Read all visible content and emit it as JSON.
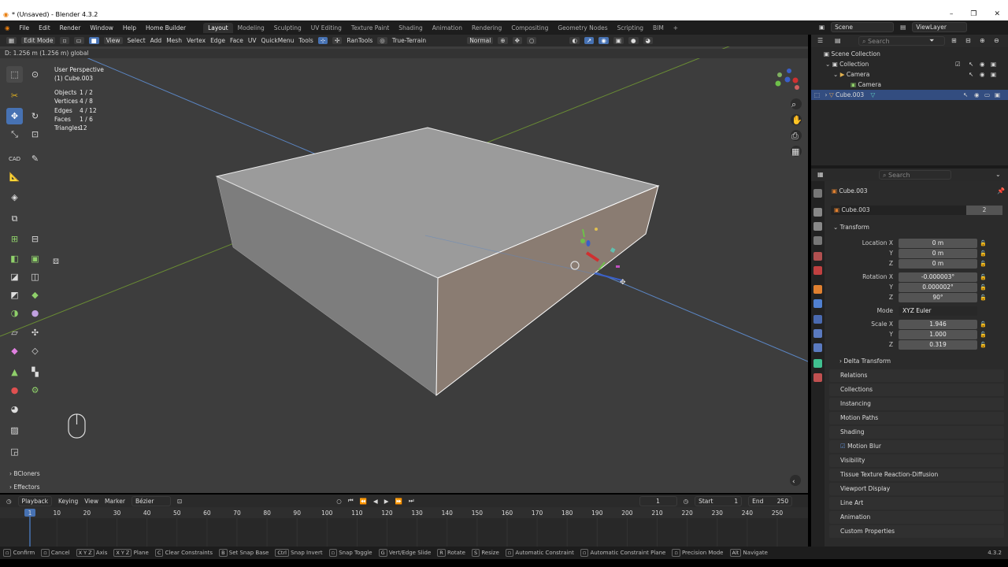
{
  "window": {
    "title": "* (Unsaved) - Blender 4.3.2",
    "minimize": "–",
    "restore": "❐",
    "close": "✕"
  },
  "menu": {
    "items": [
      "File",
      "Edit",
      "Render",
      "Window",
      "Help",
      "Home Builder"
    ],
    "tabs": [
      "Layout",
      "Modeling",
      "Sculpting",
      "UV Editing",
      "Texture Paint",
      "Shading",
      "Animation",
      "Rendering",
      "Compositing",
      "Geometry Nodes",
      "Scripting",
      "BIM"
    ],
    "active_tab": "Layout",
    "add_tab": "+",
    "scene": "Scene",
    "view_layer": "ViewLayer"
  },
  "viewport_header": {
    "mode": "Edit Mode",
    "menus": [
      "View",
      "Select",
      "Add",
      "Mesh",
      "Vertex",
      "Edge",
      "Face",
      "UV",
      "QuickMenu",
      "Tools"
    ],
    "ran_tools": "RanTools",
    "true_terrain": "True-Terrain",
    "orientation": "Normal"
  },
  "hint": "D: 1.256 m (1.256 m) global",
  "overlay": {
    "view_name": "User Perspective",
    "object_name": "(1) Cube.003",
    "stats": [
      {
        "k": "Objects",
        "v": "1 / 2"
      },
      {
        "k": "Vertices",
        "v": "4 / 8"
      },
      {
        "k": "Edges",
        "v": "4 / 12"
      },
      {
        "k": "Faces",
        "v": "1 / 6"
      },
      {
        "k": "Triangles",
        "v": "12"
      }
    ]
  },
  "toolbar": {
    "cad_label": "CAD"
  },
  "bottom_left": {
    "items": [
      "BCloners",
      "Effectors"
    ]
  },
  "outliner": {
    "search_placeholder": "Search",
    "rows": [
      {
        "label": "Scene Collection"
      },
      {
        "label": "Collection"
      },
      {
        "label": "Camera"
      },
      {
        "label": "Camera"
      },
      {
        "label": "Cube.003"
      }
    ]
  },
  "properties": {
    "search_placeholder": "Search",
    "object_title": "Cube.003",
    "object_name": "Cube.003",
    "users": "2",
    "transform_label": "Transform",
    "location_label": "Location X",
    "location": [
      "0 m",
      "0 m",
      "0 m"
    ],
    "rotation_label": "Rotation X",
    "rotation": [
      "-0.000003°",
      "0.000002°",
      "90°"
    ],
    "mode_label": "Mode",
    "mode_value": "XYZ Euler",
    "scale_label": "Scale X",
    "scale": [
      "1.946",
      "1.000",
      "0.319"
    ],
    "axis_y": "Y",
    "axis_z": "Z",
    "delta": "Delta Transform",
    "panels": [
      "Relations",
      "Collections",
      "Instancing",
      "Motion Paths",
      "Shading",
      "Motion Blur",
      "Visibility",
      "Tissue Texture Reaction-Diffusion",
      "Viewport Display",
      "Line Art",
      "Animation",
      "Custom Properties"
    ]
  },
  "timeline": {
    "menus": [
      "Playback",
      "Keying",
      "View",
      "Marker"
    ],
    "interp": "Bézier",
    "current_frame": "1",
    "start_label": "Start",
    "start": "1",
    "end_label": "End",
    "end": "250",
    "ruler": [
      "1",
      "10",
      "20",
      "30",
      "40",
      "50",
      "60",
      "70",
      "80",
      "90",
      "100",
      "110",
      "120",
      "130",
      "140",
      "150",
      "160",
      "170",
      "180",
      "190",
      "200",
      "210",
      "220",
      "230",
      "240",
      "250"
    ]
  },
  "statusbar": {
    "items": [
      {
        "key": "",
        "text": "Confirm"
      },
      {
        "key": "",
        "text": "Cancel"
      },
      {
        "key": "X Y Z",
        "text": "Axis"
      },
      {
        "key": "X Y Z",
        "text": "Plane"
      },
      {
        "key": "C",
        "text": "Clear Constraints"
      },
      {
        "key": "B",
        "text": "Set Snap Base"
      },
      {
        "key": "Ctrl",
        "text": "Snap Invert"
      },
      {
        "key": "",
        "text": "Snap Toggle"
      },
      {
        "key": "G",
        "text": "Vert/Edge Slide"
      },
      {
        "key": "R",
        "text": "Rotate"
      },
      {
        "key": "S",
        "text": "Resize"
      },
      {
        "key": "",
        "text": "Automatic Constraint"
      },
      {
        "key": "",
        "text": "Automatic Constraint Plane"
      },
      {
        "key": "",
        "text": "Precision Mode"
      },
      {
        "key": "Alt",
        "text": "Navigate"
      }
    ],
    "version": "4.3.2"
  },
  "colors": {
    "accent": "#4772b3",
    "selection": "#334d80",
    "xaxis": "#7aa13b",
    "yaxis": "#5b86c4"
  }
}
